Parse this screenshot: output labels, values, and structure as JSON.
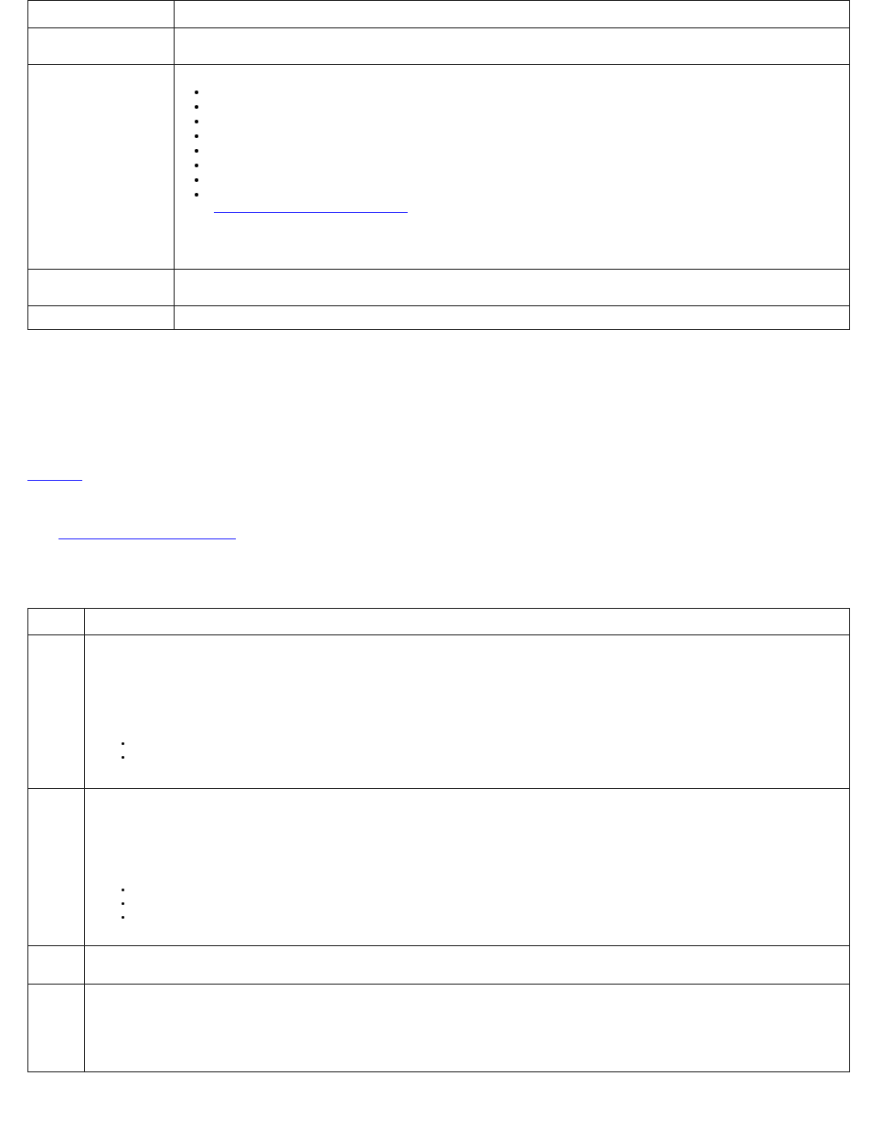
{
  "table1": {
    "rows": [
      {
        "c0": "",
        "c1": ""
      },
      {
        "c0": "",
        "c1": ""
      },
      {
        "c0": "",
        "c1_bullets": [
          "",
          "",
          "",
          "",
          "",
          "",
          "",
          ""
        ],
        "c1_link": ""
      },
      {
        "c0": "",
        "c1": ""
      },
      {
        "c0": "",
        "c1": ""
      }
    ]
  },
  "mid": {
    "link1": "",
    "link2": ""
  },
  "table2": {
    "rows": [
      {
        "c0": "",
        "c1": ""
      },
      {
        "c0": "",
        "c1_bullets": [
          "",
          ""
        ]
      },
      {
        "c0": "",
        "c1_bullets": [
          "",
          "",
          ""
        ]
      },
      {
        "c0": "",
        "c1": ""
      },
      {
        "c0": "",
        "c1": ""
      }
    ]
  }
}
